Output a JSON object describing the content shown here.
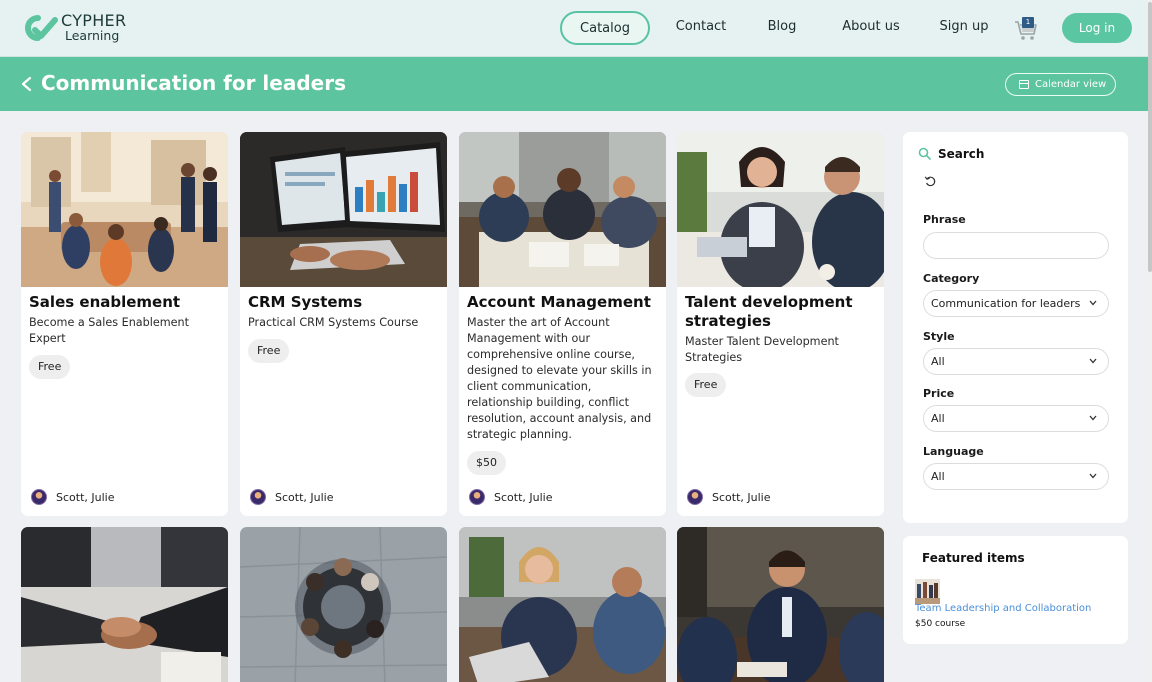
{
  "header": {
    "logo_line1": "CYPHER",
    "logo_line2": "Learning",
    "nav": [
      "Catalog",
      "Contact",
      "Blog",
      "About us",
      "Sign up"
    ],
    "cart_count": "1",
    "login_label": "Log in"
  },
  "page": {
    "title": "Communication for leaders",
    "calendar_label": "Calendar view"
  },
  "cards": [
    {
      "title": "Sales enablement",
      "desc": "Become a Sales Enablement Expert",
      "price": "Free",
      "author": "Scott, Julie"
    },
    {
      "title": "CRM Systems",
      "desc": "Practical CRM Systems Course",
      "price": "Free",
      "author": "Scott, Julie"
    },
    {
      "title": "Account Management",
      "desc": "Master the art of Account Management with our comprehensive online course, designed to elevate your skills in client communication, relationship building, conflict resolution, account analysis, and strategic planning.",
      "price": "$50",
      "author": "Scott, Julie"
    },
    {
      "title": "Talent development strategies",
      "desc": "Master Talent Development Strategies",
      "price": "Free",
      "author": "Scott, Julie"
    }
  ],
  "search": {
    "title": "Search",
    "phrase_label": "Phrase",
    "phrase_value": "",
    "category_label": "Category",
    "category_value": "Communication for leaders",
    "style_label": "Style",
    "style_value": "All",
    "price_label": "Price",
    "price_value": "All",
    "language_label": "Language",
    "language_value": "All"
  },
  "featured": {
    "title": "Featured items",
    "item_title": "Team Leadership and Collaboration",
    "item_price": "$50 course"
  },
  "colors": {
    "accent": "#5cc59f",
    "link": "#4a8fd8",
    "page_bg": "#eef0f3"
  }
}
